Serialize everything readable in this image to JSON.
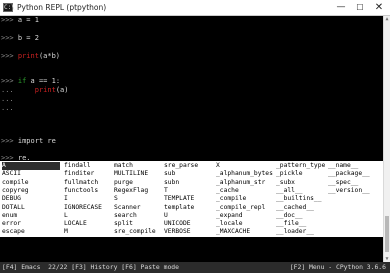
{
  "window": {
    "title": "Python REPL (ptpython)",
    "app_icon": "console-icon",
    "minimize": "—",
    "maximize": "☐",
    "close": "✕"
  },
  "repl": {
    "prompt": ">>>",
    "cont": "...",
    "lines": [
      {
        "prompt": ">>>",
        "parts": [
          "a = 1"
        ]
      },
      {
        "prompt": ">>>",
        "parts": [
          "b = 2"
        ]
      },
      {
        "prompt": ">>>",
        "fn": "print",
        "rest": "(a*b)"
      },
      {
        "prompt": ">>>",
        "kw": "if",
        "rest": " a == 1:"
      },
      {
        "prompt": "...",
        "fn": "print",
        "rest": "(a)"
      },
      {
        "prompt": "...",
        "parts": [
          ""
        ]
      },
      {
        "prompt": "...",
        "parts": [
          ""
        ]
      },
      {
        "prompt": ">>>",
        "kw": "import",
        "rest": " re"
      },
      {
        "prompt": ">>>",
        "parts": [
          "re."
        ]
      }
    ]
  },
  "completions": {
    "columns": [
      [
        "A",
        "ASCII",
        "compile",
        "copyreg",
        "DEBUG",
        "DOTALL",
        "enum",
        "error",
        "escape"
      ],
      [
        "findall",
        "finditer",
        "fullmatch",
        "functools",
        "I",
        "IGNORECASE",
        "L",
        "LOCALE",
        "M"
      ],
      [
        "match",
        "MULTILINE",
        "purge",
        "RegexFlag",
        "S",
        "Scanner",
        "search",
        "split",
        "sre_compile"
      ],
      [
        "sre_parse",
        "sub",
        "subn",
        "T",
        "TEMPLATE",
        "template",
        "U",
        "UNICODE",
        "VERBOSE"
      ],
      [
        "X",
        "_alphanum_bytes",
        "_alphanum_str",
        "_cache",
        "_compile",
        "_compile_repl",
        "_expand",
        "_locale",
        "_MAXCACHE"
      ],
      [
        "_pattern_type",
        "_pickle",
        "_subx",
        "__all__",
        "__builtins__",
        "__cached__",
        "__doc__",
        "__file__",
        "__loader__"
      ],
      [
        "__name__",
        "__package__",
        "__spec__",
        "__version__",
        "",
        "",
        "",
        "",
        ""
      ]
    ],
    "selected": "A"
  },
  "statusbar": {
    "left": "[F4] Emacs  22/22 [F3] History [F6] Paste mode",
    "right": "[F2] Menu - CPython 3.6.6"
  }
}
